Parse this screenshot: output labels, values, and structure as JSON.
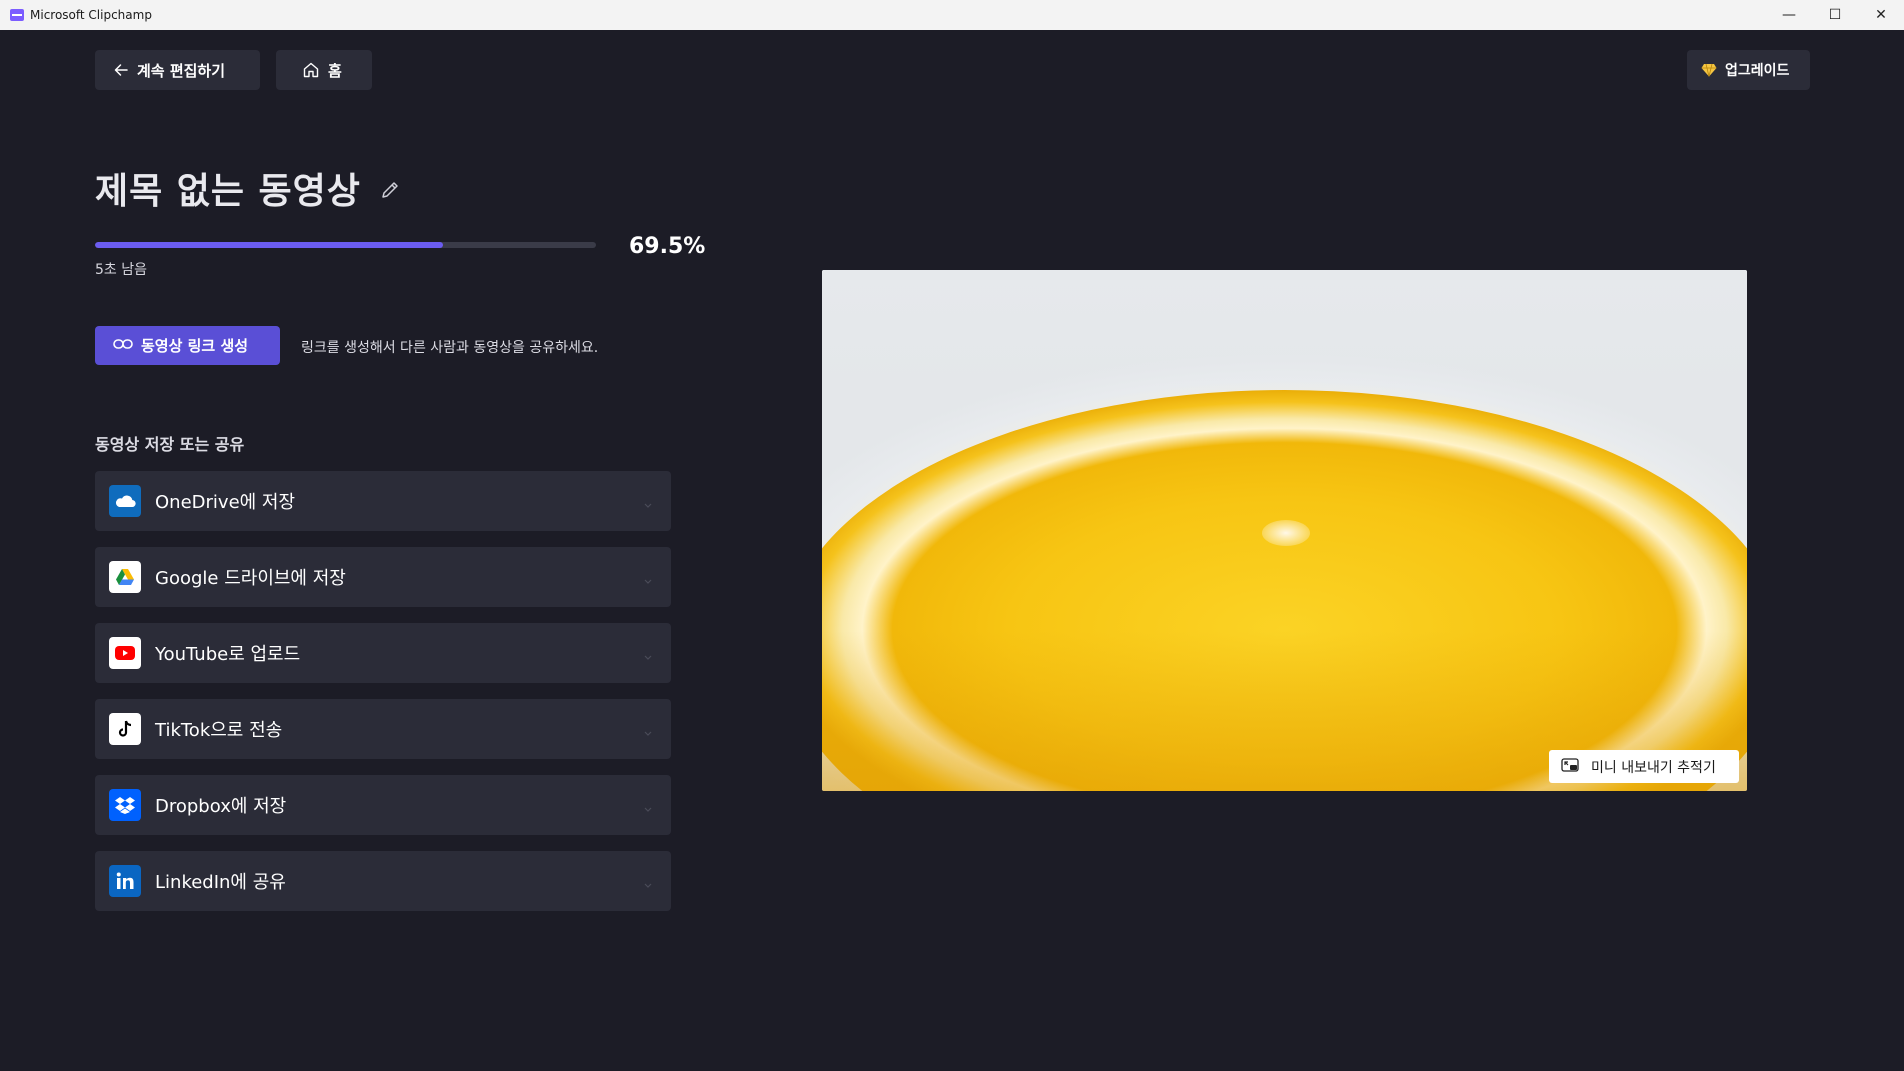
{
  "window": {
    "title": "Microsoft Clipchamp",
    "minimize": "—",
    "maximize": "☐",
    "close": "✕"
  },
  "toolbar": {
    "back_label": "계속 편집하기",
    "home_label": "홈",
    "upgrade_label": "업그레이드"
  },
  "project": {
    "title": "제목 없는 동영상"
  },
  "export": {
    "progress_fraction": 0.695,
    "progress_text": "69.5%",
    "time_left": "5초 남음"
  },
  "link": {
    "button_label": "동영상 링크 생성",
    "hint": "링크를 생성해서 다른 사람과 동영상을 공유하세요."
  },
  "share": {
    "heading": "동영상 저장 또는 공유",
    "items": [
      {
        "label": "OneDrive에 저장",
        "icon": "onedrive-icon",
        "color": "#0f6cbd"
      },
      {
        "label": "Google 드라이브에 저장",
        "icon": "google-drive-icon",
        "color": "#ffffff"
      },
      {
        "label": "YouTube로 업로드",
        "icon": "youtube-icon",
        "color": "#ffffff"
      },
      {
        "label": "TikTok으로 전송",
        "icon": "tiktok-icon",
        "color": "#ffffff"
      },
      {
        "label": "Dropbox에 저장",
        "icon": "dropbox-icon",
        "color": "#0061fe"
      },
      {
        "label": "LinkedIn에 공유",
        "icon": "linkedin-icon",
        "color": "#0a66c2"
      }
    ]
  },
  "preview": {
    "mini_tracker_label": "미니 내보내기 추적기"
  },
  "colors": {
    "background": "#1c1c26",
    "accent": "#5a4fd6",
    "progress": "#6b5cf0"
  }
}
